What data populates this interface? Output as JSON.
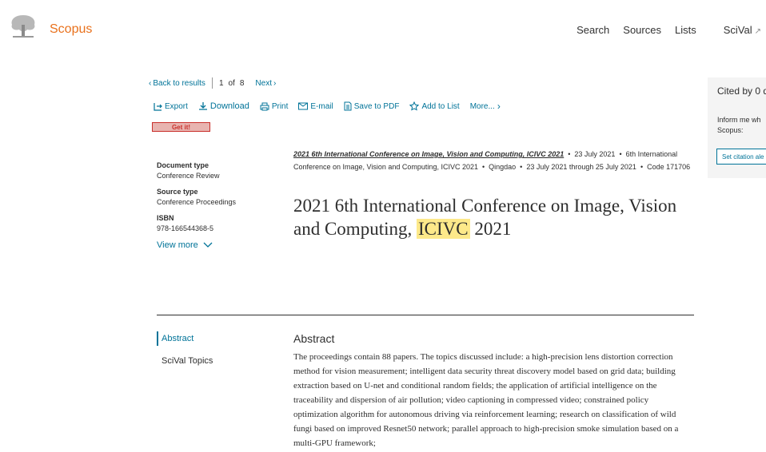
{
  "header": {
    "brand": "Scopus",
    "nav": [
      {
        "label": "Search"
      },
      {
        "label": "Sources"
      },
      {
        "label": "Lists"
      },
      {
        "label": "SciVal",
        "external": "↗"
      }
    ]
  },
  "result_nav": {
    "back_label": "Back to results",
    "position": "1",
    "of_label": "of",
    "total": "8",
    "next_label": "Next"
  },
  "toolbar": {
    "export": "Export",
    "download": "Download",
    "print": "Print",
    "email": "E-mail",
    "save_pdf": "Save to PDF",
    "add_list": "Add to List",
    "more": "More..."
  },
  "getit_label": "Get it!",
  "meta": {
    "doc_type_label": "Document type",
    "doc_type_value": "Conference Review",
    "source_type_label": "Source type",
    "source_type_value": "Conference Proceedings",
    "isbn_label": "ISBN",
    "isbn_value": "978-166544368-5",
    "view_more": "View more"
  },
  "source": {
    "conference": "2021 6th International Conference on Image, Vision and Computing, ICIVC 2021",
    "date1": "23 July 2021",
    "conf_full": "6th International Conference on Image, Vision and Computing, ICIVC 2021",
    "place": "Qingdao",
    "date_range": "23 July 2021 through 25 July 2021",
    "code": "Code 171706"
  },
  "title": {
    "before": "2021 6th International Conference on Image, Vision and Computing,",
    "highlight": "ICIVC",
    "after": "2021"
  },
  "cited": {
    "title": "Cited by 0 d",
    "inform": [
      "Inform me wh",
      "Scopus:"
    ],
    "button": "Set citation ale"
  },
  "side_nav": {
    "abstract": "Abstract",
    "scival": "SciVal Topics"
  },
  "abstract": {
    "heading": "Abstract",
    "text": "The proceedings contain 88 papers. The topics discussed include: a high-precision lens distortion correction method for vision measurement; intelligent data security threat discovery model based on grid data; building extraction based on U-net and conditional random fields; the application of artificial intelligence on the traceability and dispersion of air pollution; video captioning in compressed video; constrained policy optimization algorithm for autonomous driving via reinforcement learning; research on classification of wild fungi based on improved Resnet50 network; parallel approach to high-precision smoke simulation based on a multi-GPU framework;"
  }
}
